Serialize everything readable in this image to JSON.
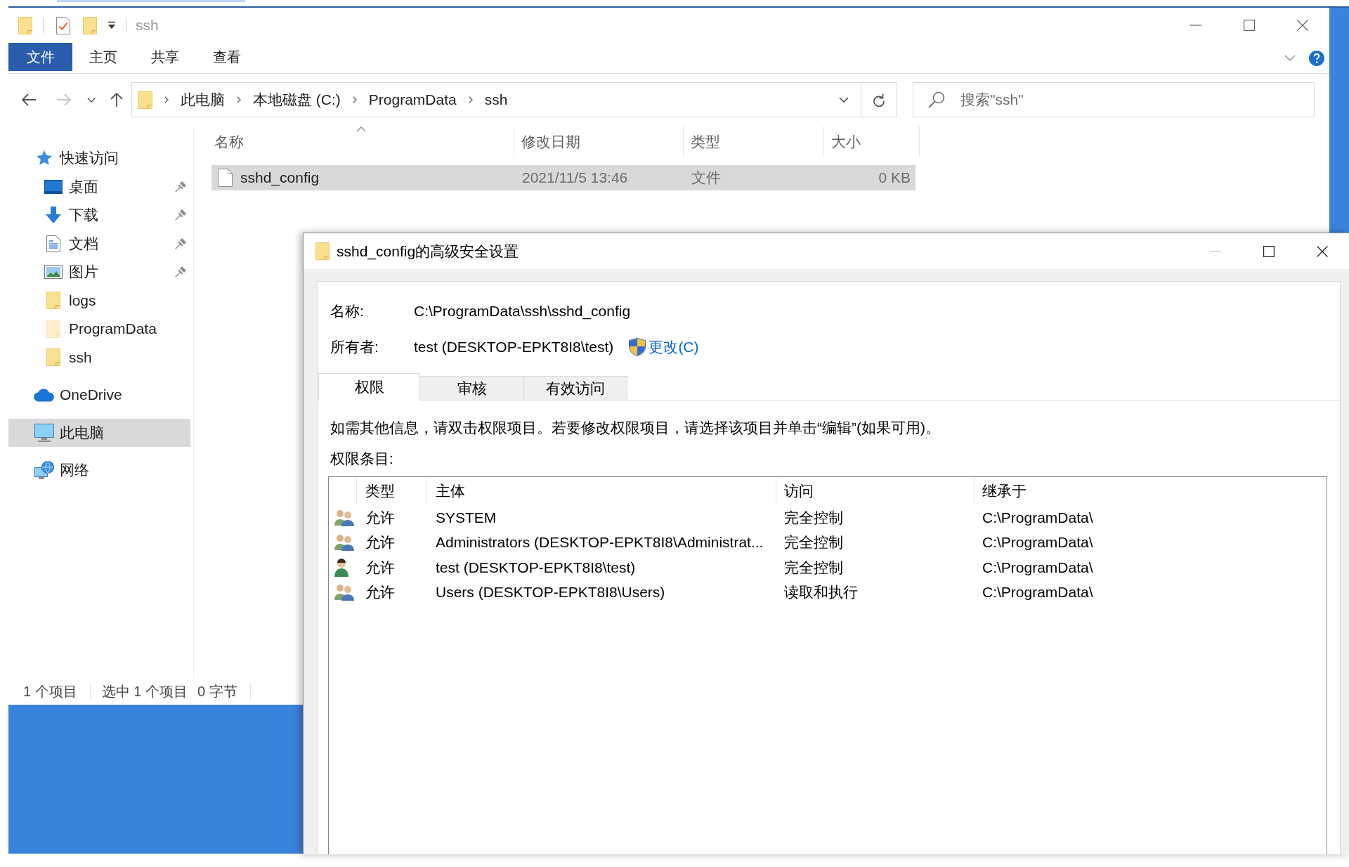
{
  "explorer": {
    "title": "ssh",
    "ribbon_tabs": [
      {
        "label": "文件",
        "kind": "file",
        "selected": false
      },
      {
        "label": "主页",
        "kind": "tab",
        "selected": false
      },
      {
        "label": "共享",
        "kind": "tab",
        "selected": false
      },
      {
        "label": "查看",
        "kind": "tab",
        "selected": false
      }
    ],
    "nav_buttons": [
      {
        "kind": "back",
        "disabled": false
      },
      {
        "kind": "forward",
        "disabled": true
      },
      {
        "kind": "recent",
        "disabled": false
      },
      {
        "kind": "up",
        "disabled": false
      }
    ],
    "address": {
      "segments": [
        "此电脑",
        "本地磁盘 (C:)",
        "ProgramData",
        "ssh"
      ]
    },
    "search": {
      "placeholder": "搜索\"ssh\""
    },
    "sidebar": {
      "items": [
        {
          "label": "快速访问",
          "kind": "star",
          "selected": false,
          "children": [
            {
              "label": "桌面",
              "kind": "desktop",
              "selected": false,
              "pinned": true,
              "hidden": false
            },
            {
              "label": "下载",
              "kind": "download",
              "selected": false,
              "pinned": true,
              "hidden": false
            },
            {
              "label": "文档",
              "kind": "document",
              "selected": false,
              "pinned": true,
              "hidden": false
            },
            {
              "label": "图片",
              "kind": "picture",
              "selected": false,
              "pinned": true,
              "hidden": false
            },
            {
              "label": "logs",
              "kind": "folder",
              "selected": false,
              "pinned": false,
              "hidden": false
            },
            {
              "label": "ProgramData",
              "kind": "folder",
              "selected": false,
              "pinned": false,
              "hidden": true
            },
            {
              "label": "ssh",
              "kind": "folder",
              "selected": false,
              "pinned": false,
              "hidden": false
            }
          ]
        },
        {
          "label": "OneDrive",
          "kind": "cloud",
          "selected": false
        },
        {
          "label": "此电脑",
          "kind": "computer",
          "selected": true
        },
        {
          "label": "网络",
          "kind": "network",
          "selected": false
        }
      ]
    },
    "files": {
      "columns": [
        {
          "label": "名称",
          "sorted": true
        },
        {
          "label": "修改日期",
          "sorted": false
        },
        {
          "label": "类型",
          "sorted": false
        },
        {
          "label": "大小",
          "sorted": false
        }
      ],
      "rows": [
        {
          "name": "sshd_config",
          "modified": "2021/11/5 13:46",
          "type": "文件",
          "size": "0 KB",
          "selected": true
        }
      ]
    },
    "status_bar": {
      "sections": [
        [
          "1 个项目"
        ],
        [
          "选中 1 个项目",
          "0 字节"
        ]
      ]
    }
  },
  "dialog": {
    "title": "sshd_config的高级安全设置",
    "controls": [
      {
        "kind": "minimize",
        "disabled": true
      },
      {
        "kind": "maximize",
        "disabled": false
      },
      {
        "kind": "close",
        "disabled": false
      }
    ],
    "name": {
      "label": "名称:",
      "value": "C:\\ProgramData\\ssh\\sshd_config"
    },
    "owner": {
      "label": "所有者:",
      "value": "test (DESKTOP-EPKT8I8\\test)",
      "link": "更改(C)"
    },
    "tabs": [
      {
        "label": "权限",
        "selected": true
      },
      {
        "label": "审核",
        "selected": false
      },
      {
        "label": "有效访问",
        "selected": false
      }
    ],
    "hint": "如需其他信息，请双击权限项目。若要修改权限项目，请选择该项目并单击“编辑”(如果可用)。",
    "entries_label": "权限条目:",
    "entries": {
      "columns": [
        "类型",
        "主体",
        "访问",
        "继承于"
      ],
      "rows": [
        {
          "kind": "group",
          "type": "允许",
          "principal": "SYSTEM",
          "access": "完全控制",
          "inherited_from": "C:\\ProgramData\\",
          "selected": false
        },
        {
          "kind": "group",
          "type": "允许",
          "principal": "Administrators (DESKTOP-EPKT8I8\\Administrat...",
          "access": "完全控制",
          "inherited_from": "C:\\ProgramData\\",
          "selected": false
        },
        {
          "kind": "user",
          "type": "允许",
          "principal": "test (DESKTOP-EPKT8I8\\test)",
          "access": "完全控制",
          "inherited_from": "C:\\ProgramData\\",
          "selected": false
        },
        {
          "kind": "group",
          "type": "允许",
          "principal": "Users (DESKTOP-EPKT8I8\\Users)",
          "access": "读取和执行",
          "inherited_from": "C:\\ProgramData\\",
          "selected": false
        }
      ]
    }
  }
}
